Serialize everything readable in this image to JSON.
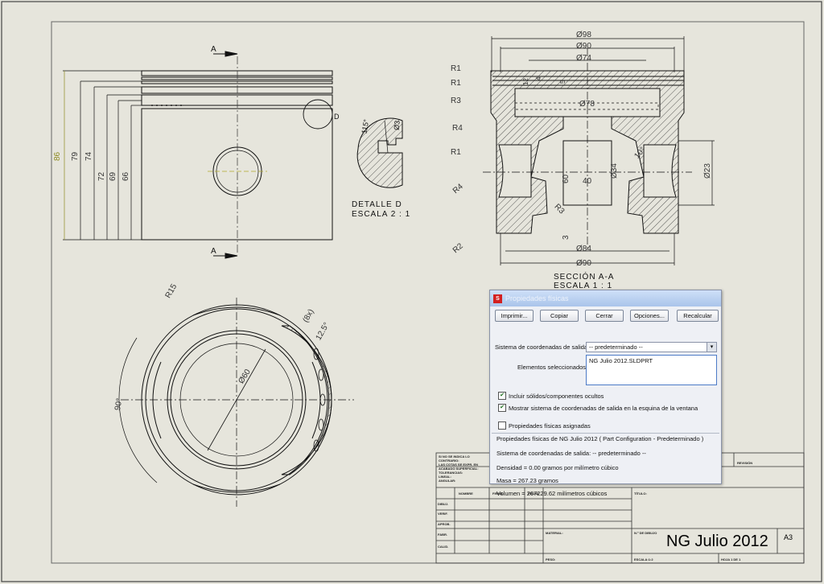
{
  "drawing": {
    "dims_left": [
      "86",
      "79",
      "74",
      "72",
      "69",
      "66"
    ],
    "section_markers": [
      "A",
      "A"
    ],
    "detail_marker": "D",
    "detail_angle": "115°",
    "detail_dia": "Ø3",
    "detail_title": "DETALLE D",
    "detail_scale": "ESCALA 2 : 1",
    "radius_labels": [
      "R1",
      "R1",
      "R3",
      "R4",
      "R1",
      "R4",
      "R2"
    ],
    "top_dims": [
      "Ø98",
      "Ø90",
      "Ø74"
    ],
    "small_dims": [
      "12",
      "4",
      "5"
    ],
    "inner_dia": "Ø78",
    "web_dims": [
      "60",
      "40",
      "3"
    ],
    "pin_dias": [
      "Ø34",
      "Ø23"
    ],
    "r3_label": "R3",
    "angle_small": "10°",
    "bottom_dims": [
      "Ø84",
      "Ø90"
    ],
    "section_title": "SECCIÓN A-A",
    "section_scale": "ESCALA 1 : 1",
    "bottom_view": {
      "r": "R15",
      "dia": "Ø60",
      "angle": "90°",
      "pattern": "(8x)",
      "pattern_angle": "12.5°"
    }
  },
  "dialog": {
    "title": "Propiedades físicas",
    "buttons": [
      "Imprimir...",
      "Copiar",
      "Cerrar",
      "Opciones...",
      "Recalcular"
    ],
    "coord_label": "Sistema de coordenadas de salida:",
    "coord_value": "-- predeterminado --",
    "selected_label": "Elementos seleccionados:",
    "selected_item": "NG Julio 2012.SLDPRT",
    "chk1": "Incluir sólidos/componentes ocultos",
    "chk2": "Mostrar sistema de coordenadas de salida en la esquina de la ventana",
    "chk3": "Propiedades físicas asignadas",
    "res1": "Propiedades físicas de NG Julio 2012 ( Part Configuration - Predeterminado )",
    "res2": "Sistema de coordenadas de salida: -- predeterminado --",
    "res3": "Densidad = 0.00 gramos por  milímetro cúbico",
    "res4": "Masa = 267.23 gramos",
    "res5": "Volumen = 267229.62  milímetros cúbicos"
  },
  "titleblock": {
    "name": "NG Julio 2012",
    "size": "A3",
    "note": [
      "SI NO SE INDICA LO",
      "CONTRARIO:",
      "LAS COTAS SE EXPR. EN",
      "ACABADO SUPERFICIAL:",
      "TOLERANCIAS:",
      "LINEAL:",
      "ANGULAR:"
    ],
    "revision": "REVISIÓN",
    "headers": [
      "NOMBRE",
      "FIRMA",
      "FECHA",
      "TÍTULO:"
    ],
    "rows": [
      "DIBUJ.",
      "VERIF.",
      "APROB.",
      "FABR.",
      "CALID."
    ],
    "material": "MATERIAL:",
    "drawing_no": "N.º DE DIBUJO",
    "weight": "PESO:",
    "scale": "ESCALA:1:2",
    "sheet": "HOJA 1 DE 1"
  }
}
